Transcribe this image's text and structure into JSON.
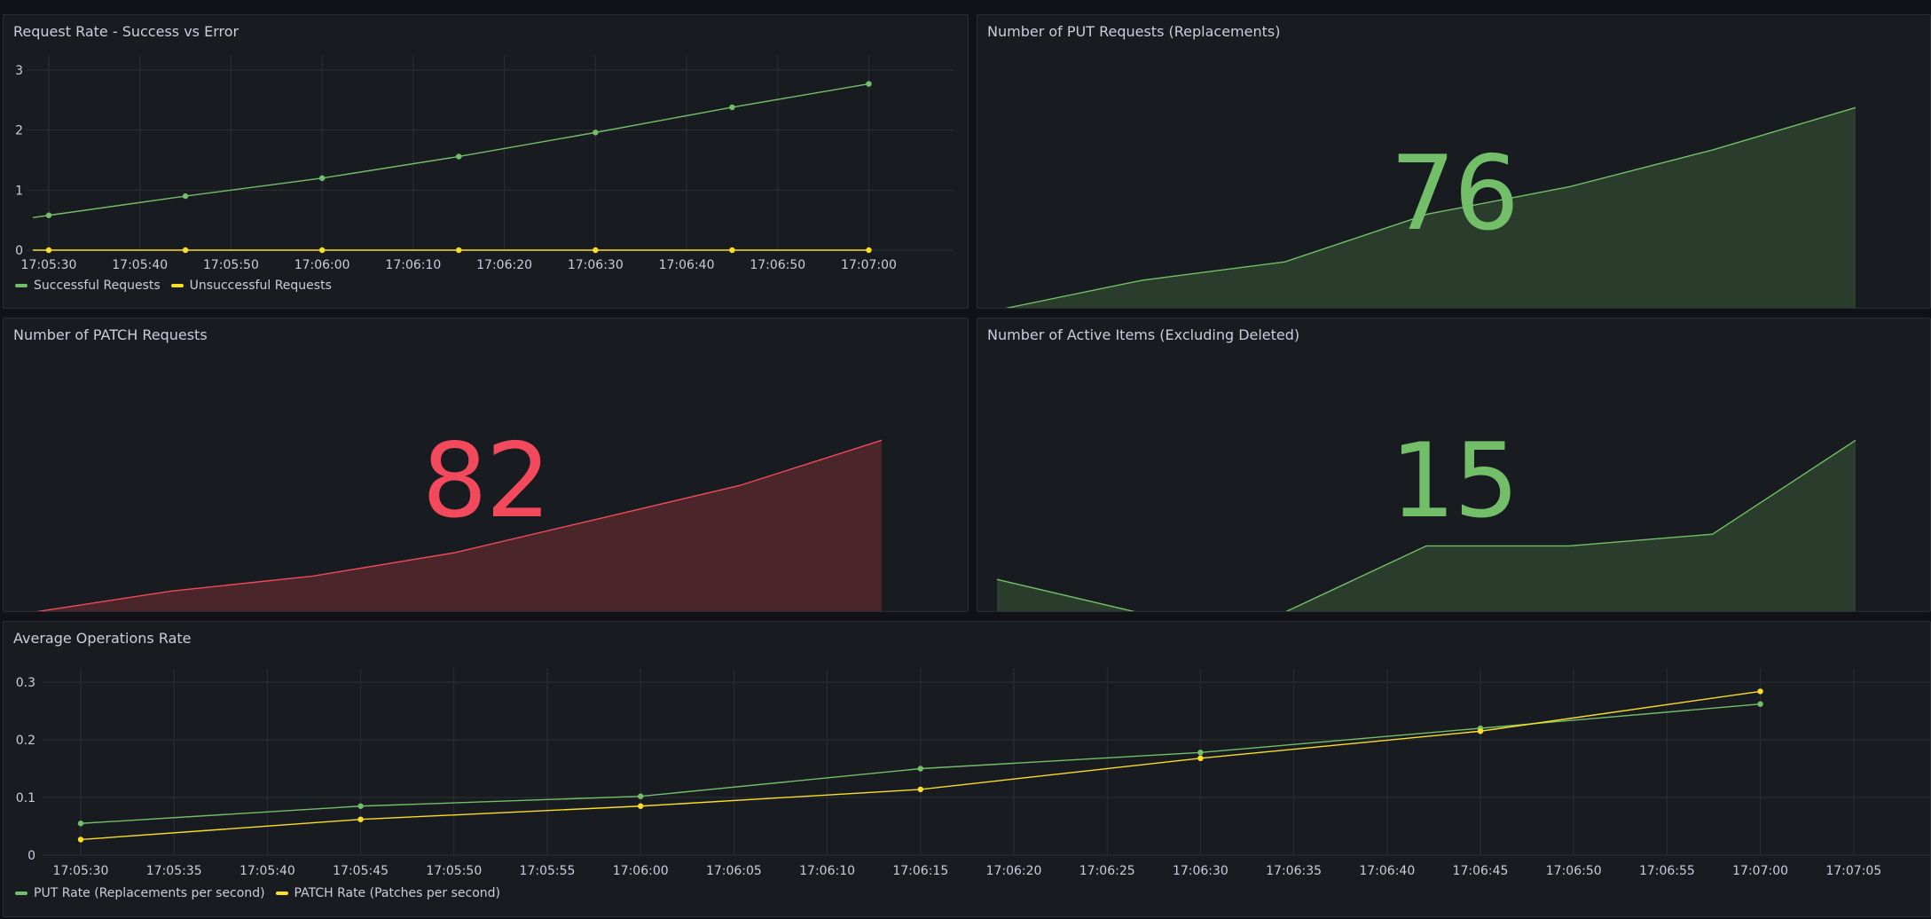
{
  "colors": {
    "green": "#73bf69",
    "yellow": "#fade2a",
    "red": "#f2495c",
    "green_fill": "#2a3c2b",
    "red_fill": "#4a262b",
    "grid": "#2c2f35"
  },
  "panels": {
    "request_rate": {
      "title": "Request Rate - Success vs Error",
      "chart_data": {
        "type": "line",
        "x": [
          "17:05:30",
          "17:05:45",
          "17:06:00",
          "17:06:15",
          "17:06:30",
          "17:06:45",
          "17:07:00"
        ],
        "x_ticks": [
          "17:05:30",
          "17:05:40",
          "17:05:50",
          "17:06:00",
          "17:06:10",
          "17:06:20",
          "17:06:30",
          "17:06:40",
          "17:06:50",
          "17:07:00"
        ],
        "y_ticks": [
          "0",
          "1",
          "2",
          "3"
        ],
        "ylim": [
          0,
          3
        ],
        "series": [
          {
            "name": "Successful Requests",
            "color": "green",
            "values": [
              0.58,
              0.9,
              1.2,
              1.56,
              1.96,
              2.38,
              2.77
            ]
          },
          {
            "name": "Unsuccessful Requests",
            "color": "yellow",
            "values": [
              0,
              0,
              0,
              0,
              0,
              0,
              0
            ]
          }
        ]
      }
    },
    "put_requests": {
      "title": "Number of PUT Requests (Replacements)",
      "value": "76",
      "color": "green",
      "sparkline": [
        0.0,
        0.16,
        0.26,
        0.52,
        0.67,
        0.87,
        1.1
      ]
    },
    "patch_requests": {
      "title": "Number of PATCH Requests",
      "value": "82",
      "color": "red",
      "sparkline": [
        0.0,
        0.13,
        0.22,
        0.36,
        0.56,
        0.76,
        1.03
      ]
    },
    "active_items": {
      "title": "Number of Active Items (Excluding Deleted)",
      "value": "15",
      "color": "green",
      "sparkline": [
        0.2,
        0.0,
        0.0,
        0.4,
        0.4,
        0.47,
        1.03
      ]
    },
    "avg_ops": {
      "title": "Average Operations Rate",
      "chart_data": {
        "type": "line",
        "x": [
          "17:05:30",
          "17:05:45",
          "17:06:00",
          "17:06:15",
          "17:06:30",
          "17:06:45",
          "17:07:00"
        ],
        "x_ticks": [
          "17:05:30",
          "17:05:35",
          "17:05:40",
          "17:05:45",
          "17:05:50",
          "17:05:55",
          "17:06:00",
          "17:06:05",
          "17:06:10",
          "17:06:15",
          "17:06:20",
          "17:06:25",
          "17:06:30",
          "17:06:35",
          "17:06:40",
          "17:06:45",
          "17:06:50",
          "17:06:55",
          "17:07:00",
          "17:07:05"
        ],
        "y_ticks": [
          "0",
          "0.1",
          "0.2",
          "0.3"
        ],
        "ylim": [
          0,
          0.3
        ],
        "series": [
          {
            "name": "PUT Rate (Replacements per second)",
            "color": "green",
            "values": [
              0.055,
              0.085,
              0.102,
              0.15,
              0.178,
              0.22,
              0.262
            ]
          },
          {
            "name": "PATCH Rate (Patches per second)",
            "color": "yellow",
            "values": [
              0.027,
              0.062,
              0.085,
              0.114,
              0.168,
              0.215,
              0.284
            ]
          }
        ]
      }
    }
  }
}
